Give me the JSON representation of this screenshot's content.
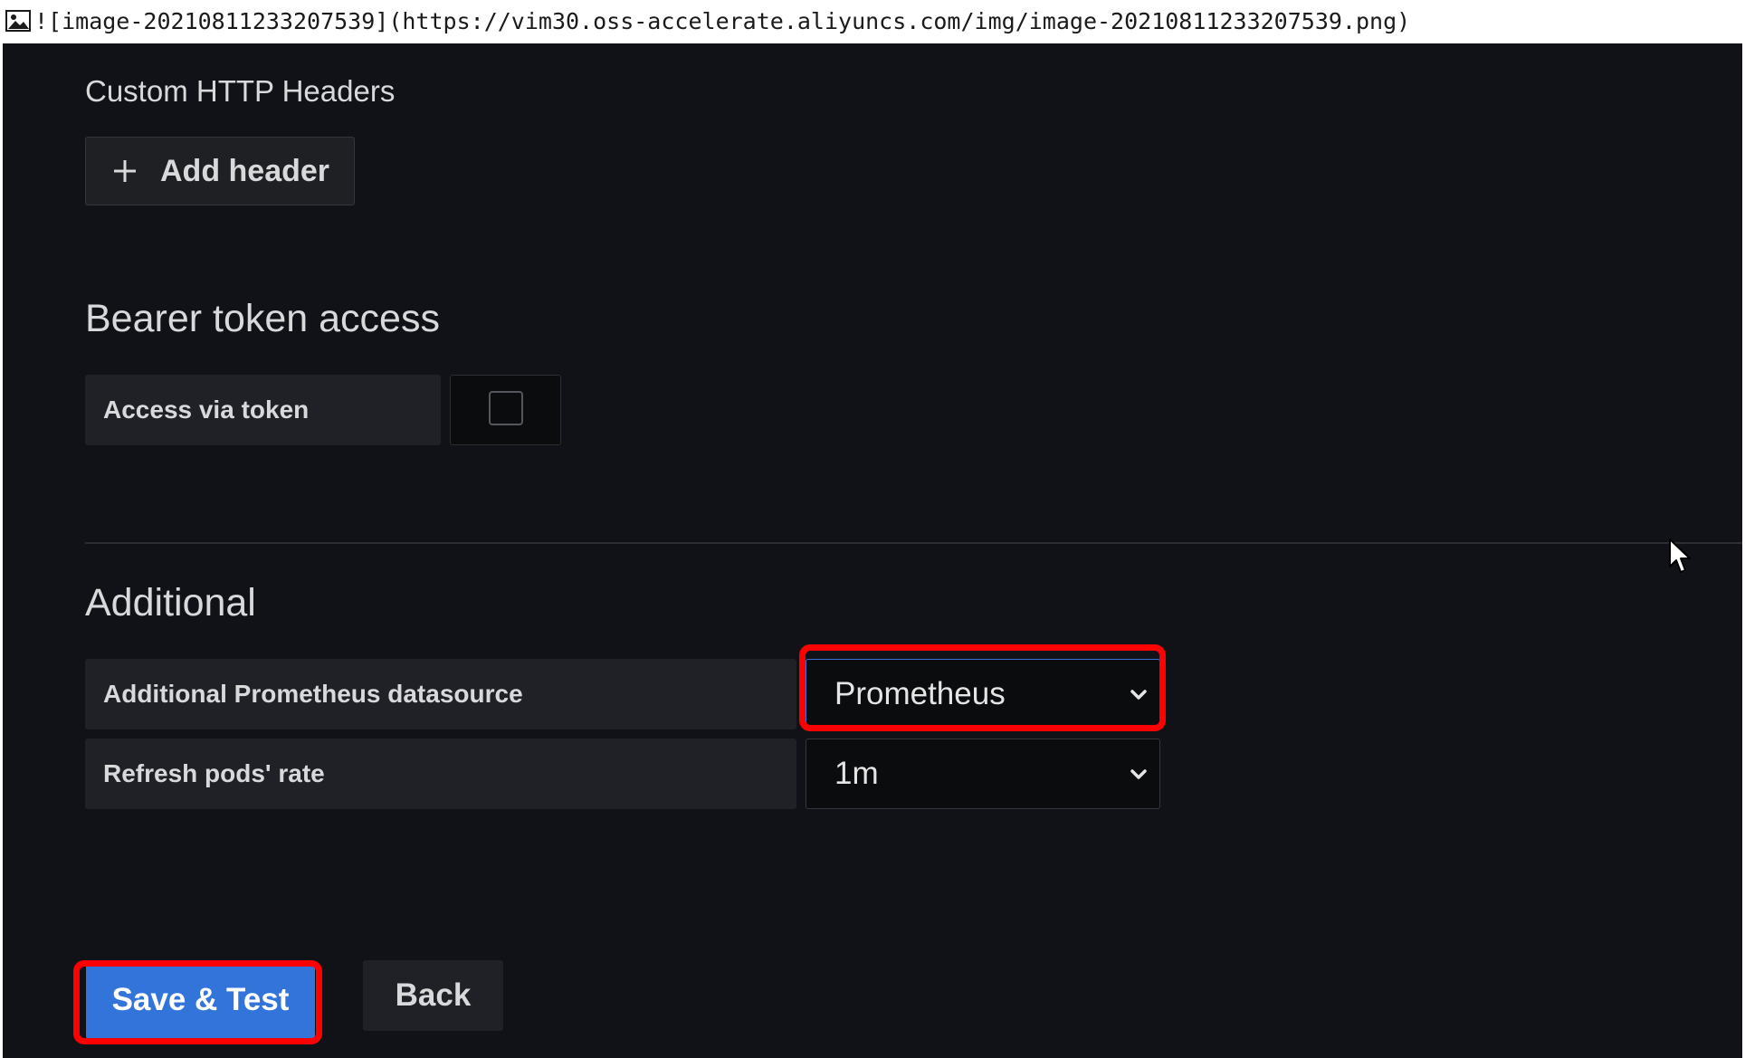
{
  "markdown_line": {
    "text": "![image-20210811233207539](https://vim30.oss-accelerate.aliyuncs.com/img/image-20210811233207539.png)",
    "icon": "broken-image-icon"
  },
  "custom_headers": {
    "title": "Custom HTTP Headers",
    "add_button_label": "Add header",
    "add_button_icon": "plus-icon"
  },
  "bearer": {
    "title": "Bearer token access",
    "access_via_token_label": "Access via token",
    "access_via_token_checked": false
  },
  "additional": {
    "title": "Additional",
    "prometheus_label": "Additional Prometheus datasource",
    "prometheus_value": "Prometheus",
    "refresh_label": "Refresh pods' rate",
    "refresh_value": "1m"
  },
  "actions": {
    "save_label": "Save & Test",
    "back_label": "Back"
  },
  "colors": {
    "panel_bg": "#111217",
    "field_bg": "#202126",
    "primary": "#3274d9",
    "highlight": "#ff0000"
  }
}
